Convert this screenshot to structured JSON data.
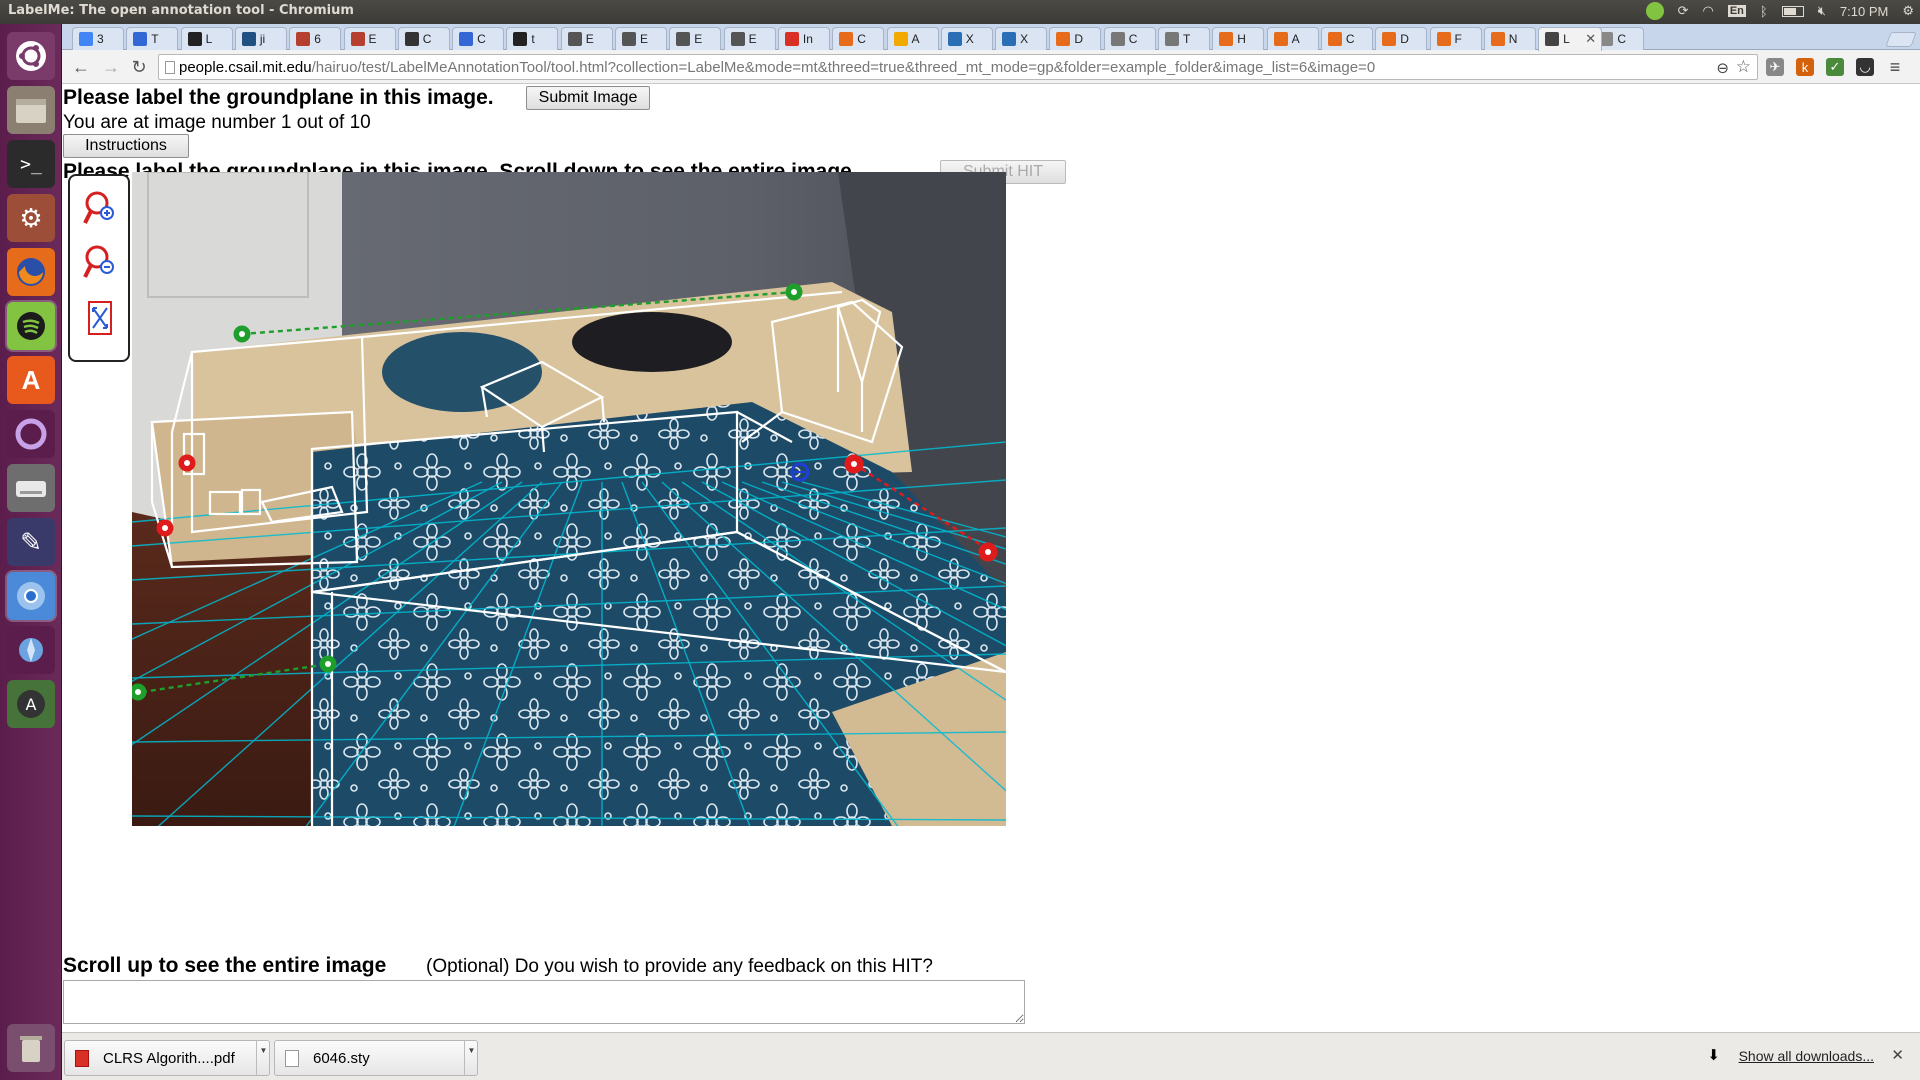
{
  "window_title": "LabelMe: The open annotation tool - Chromium",
  "panel": {
    "clock": "7:10 PM",
    "keyboard": "En"
  },
  "tabs": [
    {
      "label": "3",
      "color": "#4285f4"
    },
    {
      "label": "T",
      "color": "#3367d6"
    },
    {
      "label": "L",
      "color": "#222222"
    },
    {
      "label": "ji",
      "color": "#205081"
    },
    {
      "label": "6",
      "color": "#b5402f"
    },
    {
      "label": "E",
      "color": "#b5402f"
    },
    {
      "label": "C",
      "color": "#333333"
    },
    {
      "label": "C",
      "color": "#3367d6"
    },
    {
      "label": "t",
      "color": "#222222"
    },
    {
      "label": "E",
      "color": "#555555"
    },
    {
      "label": "E",
      "color": "#555555"
    },
    {
      "label": "E",
      "color": "#555555"
    },
    {
      "label": "E",
      "color": "#555555"
    },
    {
      "label": "In",
      "color": "#d93025"
    },
    {
      "label": "C",
      "color": "#e66b1a"
    },
    {
      "label": "A",
      "color": "#f2a900"
    },
    {
      "label": "X",
      "color": "#2a6fb5"
    },
    {
      "label": "X",
      "color": "#2a6fb5"
    },
    {
      "label": "D",
      "color": "#e66b1a"
    },
    {
      "label": "C",
      "color": "#777777"
    },
    {
      "label": "T",
      "color": "#777777"
    },
    {
      "label": "H",
      "color": "#e66b1a"
    },
    {
      "label": "A",
      "color": "#e66b1a"
    },
    {
      "label": "C",
      "color": "#e66b1a"
    },
    {
      "label": "D",
      "color": "#e66b1a"
    },
    {
      "label": "F",
      "color": "#e66b1a"
    },
    {
      "label": "N",
      "color": "#e66b1a"
    },
    {
      "label": "L",
      "color": "#444444",
      "active": true
    },
    {
      "label": "C",
      "color": "#888888"
    }
  ],
  "url": {
    "host": "people.csail.mit.edu",
    "path": "/hairuo/test/LabelMeAnnotationTool/tool.html?collection=LabelMe&mode=mt&threed=true&threed_mt_mode=gp&folder=example_folder&image_list=6&image=0"
  },
  "page": {
    "heading": "Please label the groundplane in this image.",
    "submit_image": "Submit Image",
    "counter": "You are at image number 1 out of 10",
    "instructions": "Instructions",
    "heading2": "Please label the groundplane in this image. Scroll down to see the entire image.",
    "submit_hit": "Submit HIT",
    "bottom_heading": "Scroll up to see the entire image",
    "feedback_label": "(Optional) Do you wish to provide any feedback on this HIT?",
    "feedback_value": ""
  },
  "downloads": {
    "items": [
      {
        "name": "CLRS Algorith....pdf",
        "type": "pdf"
      },
      {
        "name": "6046.sty",
        "type": "file"
      }
    ],
    "show_all": "Show all downloads..."
  },
  "colors": {
    "launcher": "#5b1d4b",
    "ground_line": "#00bcd4",
    "control_green": "#1e9e2a",
    "control_red": "#e01b1b",
    "control_blue": "#1f3fd6"
  }
}
